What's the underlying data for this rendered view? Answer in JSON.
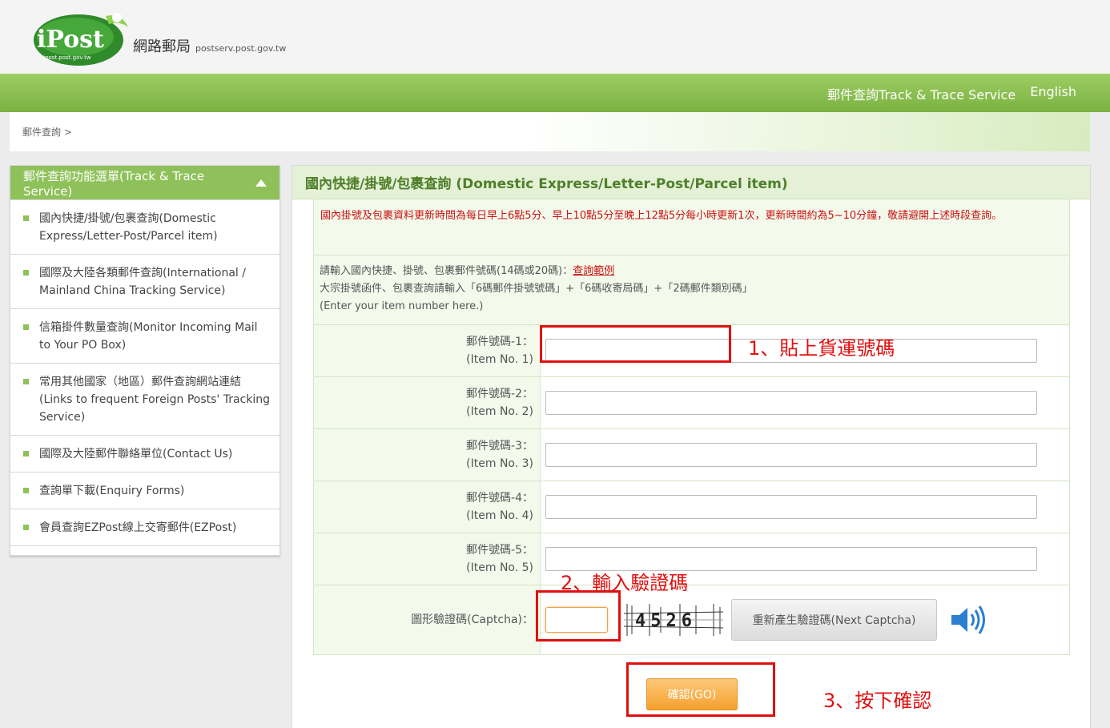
{
  "header": {
    "logo_text": "iPost",
    "logo_url_small": "ipost.post.gov.tw",
    "site_name_cn": "網路郵局",
    "site_domain": "postserv.post.gov.tw",
    "nav": [
      "郵件查詢Track & Trace Service",
      "English"
    ]
  },
  "breadcrumb": "郵件查詢 >",
  "sidebar": {
    "title": "郵件查詢功能選單(Track & Trace Service)",
    "items": [
      "國內快捷/掛號/包裹查詢(Domestic Express/Letter-Post/Parcel item)",
      "國際及大陸各類郵件查詢(International / Mainland China Tracking Service)",
      "信箱掛件數量查詢(Monitor Incoming Mail to Your PO Box)",
      "常用其他國家（地區）郵件查詢網站連結(Links to frequent Foreign Posts' Tracking Service)",
      "國際及大陸郵件聯絡單位(Contact Us)",
      "查詢單下載(Enquiry Forms)",
      "會員查詢EZPost線上交寄郵件(EZPost)"
    ]
  },
  "main": {
    "title": "國內快捷/掛號/包裹查詢 (Domestic Express/Letter-Post/Parcel item)",
    "notice": "國內掛號及包裹資料更新時間為每日早上6點5分、早上10點5分至晚上12點5分每小時更新1次，更新時間約為5~10分鐘，敬請避開上述時段查詢。",
    "instr_line1": "請輸入國內快捷、掛號、包裹郵件號碼(14碼或20碼)：",
    "instr_link": "查詢範例",
    "instr_line2": "大宗掛號函件、包裹查詢請輸入「6碼郵件掛號號碼」+「6碼收寄局碼」+「2碼郵件類別碼」",
    "instr_line3": "(Enter your item number here.)",
    "items": [
      {
        "label_cn": "郵件號碼-1：",
        "label_en": "(Item No. 1)",
        "value": ""
      },
      {
        "label_cn": "郵件號碼-2：",
        "label_en": "(Item No. 2)",
        "value": ""
      },
      {
        "label_cn": "郵件號碼-3：",
        "label_en": "(Item No. 3)",
        "value": ""
      },
      {
        "label_cn": "郵件號碼-4：",
        "label_en": "(Item No. 4)",
        "value": ""
      },
      {
        "label_cn": "郵件號碼-5：",
        "label_en": "(Item No. 5)",
        "value": ""
      }
    ],
    "captcha_label": "圖形驗證碼(Captcha)：",
    "captcha_code": "4526",
    "next_captcha": "重新產生驗證碼(Next Captcha)",
    "go_button": "確認(GO)"
  },
  "annotations": {
    "step1": "1、貼上貨運號碼",
    "step2": "2、輸入驗證碼",
    "step3": "3、按下確認",
    "color": "#e01010"
  },
  "colors": {
    "green_bar": "#8fc15a",
    "title_green": "#4f7f2a",
    "notice_red": "#cc1111",
    "go_orange": "#f5a02d"
  }
}
